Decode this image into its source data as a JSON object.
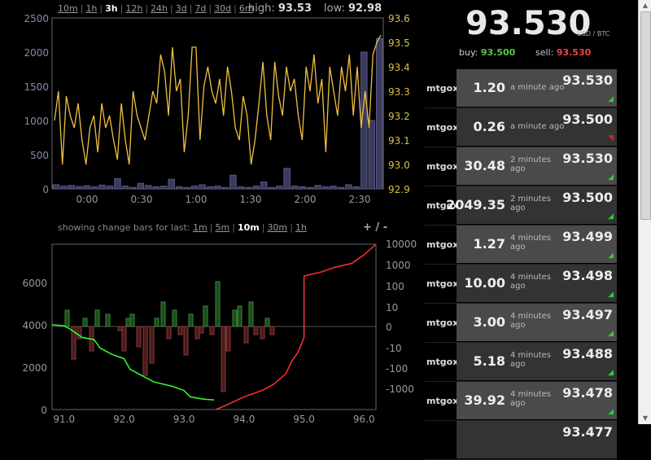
{
  "ranges": [
    "10m",
    "1h",
    "3h",
    "12h",
    "24h",
    "3d",
    "7d",
    "30d",
    "6m"
  ],
  "active_range": "3h",
  "high_label": "high:",
  "high_value": "93.53",
  "low_label": "low:",
  "low_value": "92.98",
  "change_label": "showing change bars for last:",
  "change_ranges": [
    "1m",
    "5m",
    "10m",
    "30m",
    "1h"
  ],
  "active_change_range": "10m",
  "zoom_label": "+ / -",
  "price": "93.530",
  "currency": "USD / BTC",
  "buy_label": "buy:",
  "buy_value": "93.500",
  "sell_label": "sell:",
  "sell_value": "93.530",
  "colors": {
    "line": "#f0c040",
    "buy": "#55cc44",
    "sell": "#ee4444",
    "up": "#33cc33",
    "down": "#dd2222",
    "vol": "#444466"
  },
  "trades": [
    {
      "exchange": "mtgox",
      "amount": "1.20",
      "ago": "a minute ago",
      "price": "93.530",
      "dir": "up"
    },
    {
      "exchange": "mtgox",
      "amount": "0.26",
      "ago": "a minute ago",
      "price": "93.500",
      "dir": "down"
    },
    {
      "exchange": "mtgox",
      "amount": "30.48",
      "ago": "2 minutes ago",
      "price": "93.530",
      "dir": "up"
    },
    {
      "exchange": "mtgox",
      "amount": "2049.35",
      "ago": "2 minutes ago",
      "price": "93.500",
      "dir": "up"
    },
    {
      "exchange": "mtgox",
      "amount": "1.27",
      "ago": "4 minutes ago",
      "price": "93.499",
      "dir": "up"
    },
    {
      "exchange": "mtgox",
      "amount": "10.00",
      "ago": "4 minutes ago",
      "price": "93.498",
      "dir": "up"
    },
    {
      "exchange": "mtgox",
      "amount": "3.00",
      "ago": "4 minutes ago",
      "price": "93.497",
      "dir": "up"
    },
    {
      "exchange": "mtgox",
      "amount": "5.18",
      "ago": "4 minutes ago",
      "price": "93.488",
      "dir": "up"
    },
    {
      "exchange": "mtgox",
      "amount": "39.92",
      "ago": "4 minutes ago",
      "price": "93.478",
      "dir": "up"
    },
    {
      "exchange": "",
      "amount": "",
      "ago": "",
      "price": "93.477",
      "dir": ""
    }
  ],
  "chart_data": [
    {
      "type": "line",
      "title": "",
      "x_ticks": [
        "0:00",
        "0:30",
        "1:00",
        "1:30",
        "2:00",
        "2:30"
      ],
      "y_left_ticks": [
        0,
        500,
        1000,
        1500,
        2000,
        2500
      ],
      "y_right_ticks": [
        92.9,
        93.0,
        93.1,
        93.2,
        93.3,
        93.4,
        93.5,
        93.6
      ],
      "ylim_right": [
        92.9,
        93.6
      ],
      "ylim_left": [
        0,
        2500
      ],
      "price_series": [
        93.18,
        93.3,
        93.0,
        93.28,
        93.2,
        93.15,
        93.25,
        93.1,
        93.0,
        93.15,
        93.2,
        93.05,
        93.25,
        93.15,
        93.2,
        93.1,
        93.02,
        93.25,
        93.1,
        93.0,
        93.3,
        93.2,
        93.15,
        93.1,
        93.2,
        93.3,
        93.25,
        93.45,
        93.38,
        93.2,
        93.48,
        93.3,
        93.35,
        93.05,
        93.2,
        93.48,
        93.48,
        93.1,
        93.32,
        93.4,
        93.3,
        93.25,
        93.35,
        93.2,
        93.4,
        93.3,
        93.15,
        93.1,
        93.28,
        93.2,
        93.0,
        93.1,
        93.25,
        93.42,
        93.2,
        93.1,
        93.42,
        93.28,
        93.2,
        93.4,
        93.3,
        93.35,
        93.2,
        93.1,
        93.4,
        93.3,
        93.45,
        93.25,
        93.35,
        93.05,
        93.4,
        93.3,
        93.2,
        93.4,
        93.3,
        93.45,
        93.2,
        93.4,
        93.15,
        93.3,
        93.15,
        93.45,
        93.5,
        93.53
      ],
      "volume_series": [
        60,
        40,
        50,
        35,
        45,
        30,
        55,
        40,
        150,
        40,
        20,
        80,
        50,
        30,
        40,
        140,
        30,
        20,
        40,
        60,
        30,
        40,
        20,
        200,
        30,
        20,
        40,
        100,
        20,
        40,
        300,
        40,
        30,
        20,
        50,
        30,
        40,
        20,
        60,
        30,
        2000,
        1000,
        2200
      ]
    },
    {
      "type": "area",
      "title": "",
      "x_ticks": [
        "91.0",
        "92.0",
        "93.0",
        "94.0",
        "95.0",
        "96.0"
      ],
      "y_left_ticks": [
        0,
        2000,
        4000,
        6000
      ],
      "y_right_ticks": [
        "-1000",
        "-100",
        "-10",
        "0",
        "10",
        "100",
        "1000",
        "10000"
      ],
      "xlim": [
        90.8,
        96.2
      ],
      "ylim_left": [
        0,
        7800
      ],
      "bids": [
        [
          90.8,
          4000
        ],
        [
          91.0,
          3950
        ],
        [
          91.1,
          3800
        ],
        [
          91.2,
          3600
        ],
        [
          91.3,
          3400
        ],
        [
          91.5,
          3300
        ],
        [
          91.6,
          2900
        ],
        [
          91.8,
          2600
        ],
        [
          92.0,
          2400
        ],
        [
          92.1,
          1900
        ],
        [
          92.3,
          1600
        ],
        [
          92.5,
          1300
        ],
        [
          92.8,
          1100
        ],
        [
          93.0,
          900
        ],
        [
          93.1,
          600
        ],
        [
          93.3,
          500
        ],
        [
          93.5,
          450
        ]
      ],
      "asks": [
        [
          93.53,
          0
        ],
        [
          93.7,
          200
        ],
        [
          94.0,
          600
        ],
        [
          94.3,
          900
        ],
        [
          94.5,
          1200
        ],
        [
          94.7,
          1700
        ],
        [
          94.8,
          2300
        ],
        [
          94.9,
          2700
        ],
        [
          95.0,
          3400
        ],
        [
          95.0,
          6300
        ],
        [
          95.3,
          6500
        ],
        [
          95.5,
          6700
        ],
        [
          95.8,
          6900
        ],
        [
          96.0,
          7300
        ],
        [
          96.2,
          7800
        ]
      ]
    }
  ]
}
